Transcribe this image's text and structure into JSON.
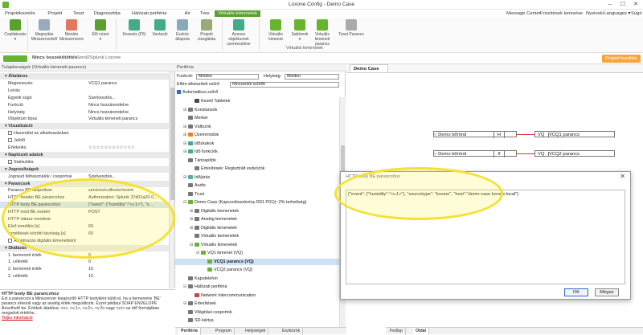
{
  "window": {
    "title": "Loxone Config - Demo Case",
    "minimize": "–",
    "maximize": "☐",
    "close": "✕"
  },
  "menu": {
    "left": [
      "Projektkezelés",
      "Projekt",
      "Teszt",
      "Diagnosztika",
      "Hálózati periféria",
      "Air",
      "Tree",
      "Virtuális kimenetek"
    ],
    "right": [
      "Message Center",
      "Frissítések keresése",
      "Nyelvek/Languages ▾",
      "Súgó"
    ]
  },
  "ribbon": {
    "buttons": [
      {
        "label": "Csatlakozás",
        "sub": "▾"
      },
      {
        "label": "Megnyitás Miniszerverből"
      },
      {
        "label": "Mentés Miniszerverre"
      },
      {
        "label": "Élő nézet",
        "sub": "▾"
      },
      {
        "label": "Keresés (F5)"
      },
      {
        "label": "Varázsló"
      },
      {
        "label": "Eszköz állapota"
      },
      {
        "label": "Projekt vizsgálata"
      },
      {
        "label": "Azonos objektumok szerkesztése"
      },
      {
        "label": "Virtuális kimenet"
      },
      {
        "label": "Sablonok",
        "sub": "▾"
      },
      {
        "label": "Virtuális kimeneti parancs"
      },
      {
        "label": "Teszt Parancs"
      }
    ],
    "group_label": "Virtuális kimenetek"
  },
  "doc_tabs": {
    "title": "Nincs összekötöttés",
    "sub": "Send2Splunk Loxone",
    "action": "Projekt buzdítás"
  },
  "properties": {
    "header": "Tulajdonságok (Virtuális kimeneti parancs)",
    "rows": [
      {
        "type": "sec",
        "k": "Általános"
      },
      {
        "k": "Megnevezés",
        "v": "VCQ1 parancs"
      },
      {
        "k": "Leírás",
        "v": ""
      },
      {
        "k": "Egyedi súgó",
        "v": "Szerkesztés..."
      },
      {
        "k": "Funkció",
        "v": "Nincs hozzárendelve"
      },
      {
        "k": "Helyiség",
        "v": "Nincs hozzárendelve"
      },
      {
        "k": "Objektum típus",
        "v": "Virtuális kimeneti parancs"
      },
      {
        "type": "sec",
        "k": "Vizualizáció"
      },
      {
        "k": "Használat az alkalmazásban",
        "v": "",
        "cb": true
      },
      {
        "k": "Jelölő",
        "v": "",
        "cb": true
      },
      {
        "k": "Értékelés",
        "v": "☆☆☆☆☆☆☆☆☆☆☆☆"
      },
      {
        "type": "sec",
        "k": "Naplózott adatok"
      },
      {
        "k": "Statisztika",
        "v": "",
        "cb": true
      },
      {
        "type": "sec",
        "k": "Jogosultságok"
      },
      {
        "k": "Jogosult felhasználók / csoportok",
        "v": "Szerkesztés..."
      },
      {
        "type": "sec",
        "k": "Parancsok"
      },
      {
        "k": "Parancs BE állapotban",
        "v": "services/collector/event"
      },
      {
        "k": "HTTP header BE parancshoz",
        "v": "Authorization: Splunk 37d01a20-0..."
      },
      {
        "type": "hi",
        "k": "HTTP body BE parancshoz",
        "v": "{\"event\": {\"humidity\":\"<v.1>\"}, \"s..."
      },
      {
        "k": "HTTP mód BE esetén",
        "v": "POST"
      },
      {
        "k": "HTTP válasz mentése",
        "v": ""
      },
      {
        "k": "Első ismétlés [s]",
        "v": "60"
      },
      {
        "k": "Ismétlések közötti távolság [s]",
        "v": "60"
      },
      {
        "k": "Alkalmazás digitális kimenetként",
        "v": "",
        "cb": true
      },
      {
        "type": "sec",
        "k": "Skálázás"
      },
      {
        "k": "1. bemeneti érték",
        "v": "0"
      },
      {
        "k": "1. célérték",
        "v": "0"
      },
      {
        "k": "2. bemeneti érték",
        "v": "10"
      },
      {
        "k": "2. célérték",
        "v": "10"
      }
    ]
  },
  "description": {
    "title": "HTTP body BE parancshoz",
    "text": "Ezt a parancsot a Miniszerver kiegészítő HTTP bodyként küldi el, ha a bemenetre 'BE' parancs érkezik vagy az analóg érték megváltozik. Ezzel például SOAP ENVELOPE illeszthető be. Értékek átadása: <v>, <v.1>, <v.2>, <v.3> vagy <v.t> az idő formájában megadott értékhe...",
    "link": "Teljes információ"
  },
  "periphery": {
    "header": "Periféria",
    "function_label": "Funkció:",
    "function_value": "Minden",
    "room_label": "Helyiség:",
    "room_value": "Minden",
    "preset_label": "Előre elkészített szűrő",
    "preset_value": "Nincsenek szűrők",
    "auto_filter": "Automatikus szűrő",
    "tree": [
      {
        "d": 1,
        "l": "Kezelt Tabletek",
        "c": "#4a4a4a",
        "e": ""
      },
      {
        "d": 0,
        "l": "Konstansok",
        "c": "#777",
        "e": "⊞"
      },
      {
        "d": 0,
        "l": "Merker",
        "c": "#777",
        "e": ""
      },
      {
        "d": 0,
        "l": "Változók",
        "c": "#777",
        "e": "⊞"
      },
      {
        "d": 0,
        "l": "Üzemmódok",
        "c": "#e08a1e",
        "e": "⊞"
      },
      {
        "d": 0,
        "l": "Időzkakok",
        "c": "#4a8",
        "e": "⊞"
      },
      {
        "d": 0,
        "l": "Idő funkciók",
        "c": "#4a8",
        "e": "⊞"
      },
      {
        "d": 0,
        "l": "Tárinapítók",
        "c": "#777",
        "e": ""
      },
      {
        "d": 1,
        "l": "Értesítések: Regisztrált eszközök",
        "c": "#777",
        "e": ""
      },
      {
        "d": 0,
        "l": "Időjárás",
        "c": "#5aa",
        "e": "⊞"
      },
      {
        "d": 0,
        "l": "Audio",
        "c": "#777",
        "e": ""
      },
      {
        "d": 0,
        "l": "Trust",
        "c": "#777",
        "e": ""
      },
      {
        "d": 0,
        "l": "Demo Case (Kapcsolószekrény R01 P01)(~2% terheltség)",
        "c": "#69b42e",
        "e": "⊟"
      },
      {
        "d": 1,
        "l": "Digitális bemenetek",
        "c": "#777",
        "e": "⊞"
      },
      {
        "d": 1,
        "l": "Analóg bemenetek",
        "c": "#777",
        "e": "⊞"
      },
      {
        "d": 1,
        "l": "Digitális kimenetek",
        "c": "#777",
        "e": "⊞"
      },
      {
        "d": 1,
        "l": "Virtuális bemenetek",
        "c": "#777",
        "e": ""
      },
      {
        "d": 1,
        "l": "Virtuális kimenetek",
        "c": "#69b42e",
        "e": "⊟"
      },
      {
        "d": 2,
        "l": "VQ1 kimenet (VQ)",
        "c": "#69b42e",
        "e": "⊟"
      },
      {
        "d": 3,
        "l": "VCQ1 parancs (VQ)",
        "c": "#69b42e",
        "e": "",
        "sel": true
      },
      {
        "d": 3,
        "l": "VCQ2 parancs (VQ)",
        "c": "#69b42e",
        "e": ""
      },
      {
        "d": 0,
        "l": "Kaputelefon",
        "c": "#777",
        "e": ""
      },
      {
        "d": 0,
        "l": "Hálózati periféria",
        "c": "#777",
        "e": "⊟"
      },
      {
        "d": 1,
        "l": "Network Intercommunication",
        "c": "#c44",
        "e": ""
      },
      {
        "d": 0,
        "l": "Értesítések",
        "c": "#777",
        "e": "⊞"
      },
      {
        "d": 0,
        "l": "Világítási csoportok",
        "c": "#777",
        "e": ""
      },
      {
        "d": 0,
        "l": "SD kártya",
        "c": "#777",
        "e": ""
      }
    ]
  },
  "bottom_tabs": [
    "Periféria",
    "Program",
    "Helyiségek",
    "Eszközök"
  ],
  "canvas": {
    "tab": "Demo Case",
    "blocks": [
      {
        "name": "Demo bőrönd",
        "val": "H",
        "tag": "VQ",
        "cmd": "VCQ1 parancs"
      },
      {
        "name": "Demo bőrönd",
        "val": "ϑ",
        "tag": "VQ",
        "cmd": "VCQ2 parancs"
      }
    ],
    "bottom_tabs": [
      "Fedlap",
      "Oldal"
    ]
  },
  "dialog": {
    "title": "HTTP body BE parancshoz",
    "close": "✕",
    "body": "{\"event\": {\"humidity\":\"<v.1>\"}, \"sourcetype\": \"loxone\", \"host\":\"demo-case.loxone.local\"}",
    "ok": "OK",
    "cancel": "Mégse"
  },
  "colors": {
    "accent": "#69b42e",
    "highlight": "#f5e132",
    "orange": "#f6a53a"
  }
}
